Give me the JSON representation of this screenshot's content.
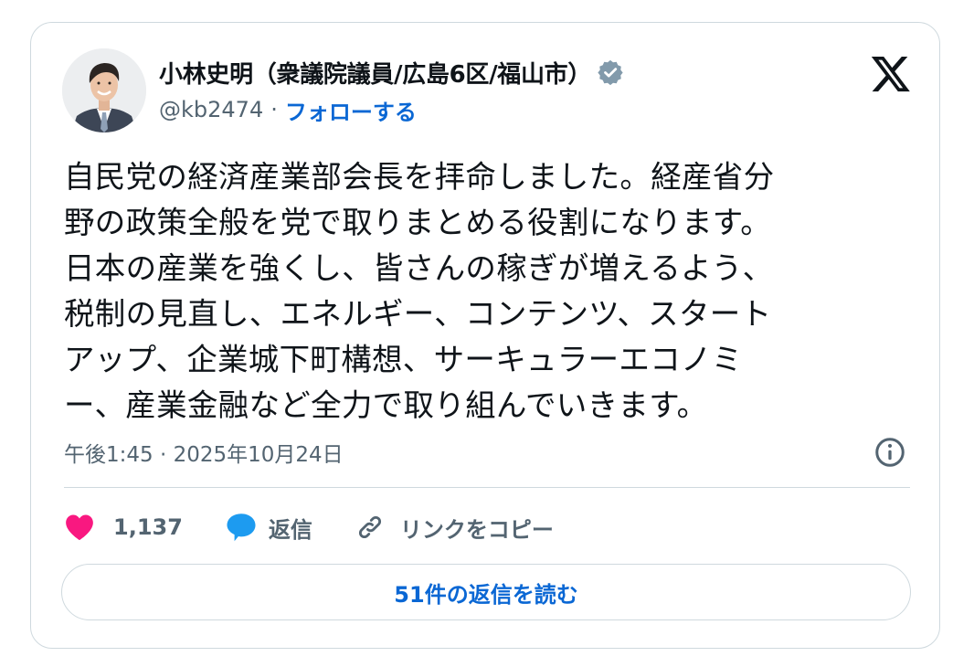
{
  "author": {
    "display_name": "小林史明（衆議院議員/広島6区/福山市）",
    "handle": "@kb2474",
    "separator": "·",
    "follow_label": "フォローする"
  },
  "icons": {
    "verified": "verified-badge-icon",
    "logo": "x-logo-icon",
    "info": "info-icon",
    "like": "heart-icon",
    "reply": "speech-bubble-icon",
    "copy": "link-icon"
  },
  "tweet": {
    "text": "自民党の経済産業部会長を拝命しました。経産省分\n野の政策全般を党で取りまとめる役割になります。\n日本の産業を強くし、皆さんの稼ぎが増えるよう、\n税制の見直し、エネルギー、コンテンツ、スタート\nアップ、企業城下町構想、サーキュラーエコノミ\nー、産業金融など全力で取り組んでいきます。",
    "timestamp": "午後1:45 · 2025年10月24日"
  },
  "actions": {
    "like_count": "1,137",
    "reply_label": "返信",
    "copy_link_label": "リンクをコピー"
  },
  "read_replies_label": "51件の返信を読む",
  "colors": {
    "text": "#0f1419",
    "secondary": "#536471",
    "link": "#0a67d4",
    "like": "#f91880",
    "reply": "#1d9bf0",
    "verified": "#829aab",
    "border": "#cfd9de"
  }
}
